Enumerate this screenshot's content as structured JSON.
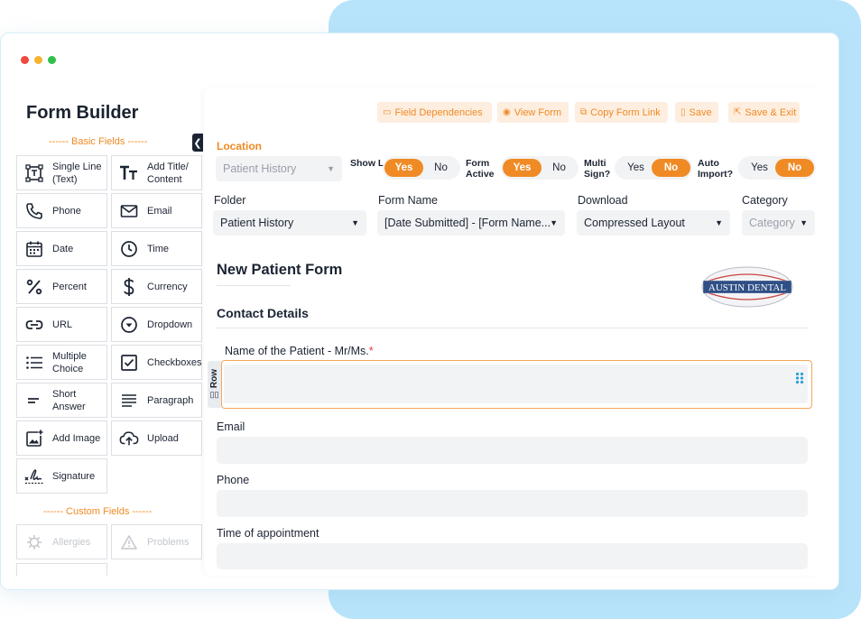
{
  "window": {
    "dots": [
      "#f0493e",
      "#f5b52e",
      "#2fc149"
    ],
    "title": "Form Builder"
  },
  "sidebar": {
    "basic_header": "------ Basic Fields ------",
    "custom_header": "------ Custom Fields ------",
    "fields": [
      {
        "label": "Single Line (Text)",
        "icon": "single-line-icon"
      },
      {
        "label": "Add Title/ Content",
        "icon": "title-icon"
      },
      {
        "label": "Phone",
        "icon": "phone-icon"
      },
      {
        "label": "Email",
        "icon": "email-icon"
      },
      {
        "label": "Date",
        "icon": "calendar-icon"
      },
      {
        "label": "Time",
        "icon": "clock-icon"
      },
      {
        "label": "Percent",
        "icon": "percent-icon"
      },
      {
        "label": "Currency",
        "icon": "dollar-icon"
      },
      {
        "label": "URL",
        "icon": "link-icon"
      },
      {
        "label": "Dropdown",
        "icon": "dropdown-icon"
      },
      {
        "label": "Multiple Choice",
        "icon": "list-icon"
      },
      {
        "label": "Checkboxes",
        "icon": "checkbox-icon"
      },
      {
        "label": "Short Answer",
        "icon": "short-answer-icon"
      },
      {
        "label": "Paragraph",
        "icon": "paragraph-icon"
      },
      {
        "label": "Add Image",
        "icon": "image-icon"
      },
      {
        "label": "Upload",
        "icon": "upload-icon"
      },
      {
        "label": "Signature",
        "icon": "signature-icon"
      }
    ],
    "custom_fields": [
      {
        "label": "Allergies",
        "icon": "virus-icon"
      },
      {
        "label": "Problems",
        "icon": "warning-icon"
      }
    ]
  },
  "toolbar": {
    "field_dependencies": "Field Dependencies",
    "view_form": "View Form",
    "copy_form_link": "Copy Form Link",
    "save": "Save",
    "save_exit": "Save & Exit"
  },
  "settings": {
    "location_label": "Location",
    "location_value": "Patient History",
    "show_logo": {
      "label": "Show Logo?",
      "yes": "Yes",
      "no": "No",
      "selected": "Yes"
    },
    "form_active": {
      "label": "Form Active",
      "yes": "Yes",
      "no": "No",
      "selected": "Yes"
    },
    "multi_sign": {
      "label": "Multi Sign?",
      "yes": "Yes",
      "no": "No",
      "selected": "No"
    },
    "auto_import": {
      "label": "Auto Import?",
      "yes": "Yes",
      "no": "No",
      "selected": "No"
    },
    "folder_label": "Folder",
    "folder_value": "Patient History",
    "form_name_label": "Form Name",
    "form_name_value": "[Date Submitted] - [Form Name...",
    "download_label": "Download",
    "download_value": "Compressed Layout",
    "category_label": "Category",
    "category_value": "Category"
  },
  "form": {
    "title": "New Patient Form",
    "logo_text": "AUSTIN DENTAL",
    "section": "Contact Details",
    "row_handle": "Row",
    "fields": [
      {
        "label": "Name of the Patient - Mr/Ms.",
        "required": "*"
      },
      {
        "label": "Email"
      },
      {
        "label": "Phone"
      },
      {
        "label": "Time of appointment"
      }
    ]
  },
  "colors": {
    "accent": "#f08a24",
    "backdrop": "#b8e4fb",
    "field_bg": "#f2f3f5"
  }
}
